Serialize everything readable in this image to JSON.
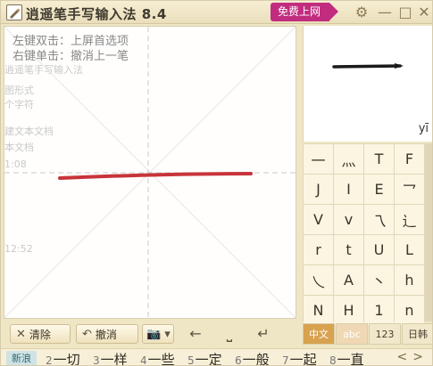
{
  "window": {
    "title": "逍遥笔手写输入法 8.4",
    "free_net_label": "免费上网",
    "settings_icon": "gear-icon",
    "minimize_label": "—",
    "maximize_label": "□",
    "close_label": "✕"
  },
  "canvas": {
    "hint_double": "左键双击：上屏首选项",
    "hint_single": "右键单击：撤消上一笔",
    "background_ghost_text": [
      "逍遥笔手写输入法",
      "图形式",
      "个字符",
      "建文本文档",
      "本文档",
      "1:08",
      "12:52"
    ],
    "stroke_color": "#c8343a"
  },
  "preview": {
    "pinyin": "yī"
  },
  "candidates_grid": [
    [
      "一",
      "灬",
      "T",
      "F"
    ],
    [
      "J",
      "I",
      "E",
      "乛"
    ],
    [
      "V",
      "v",
      "乁",
      "辶"
    ],
    [
      "r",
      "t",
      "U",
      "L"
    ],
    [
      "乀",
      "A",
      "丶",
      "h"
    ],
    [
      "N",
      "H",
      "1",
      "n"
    ]
  ],
  "modes": [
    {
      "label": "中文",
      "active": true
    },
    {
      "label": "abc",
      "active": false
    },
    {
      "label": "123",
      "active": false
    },
    {
      "label": "日韩",
      "active": false
    }
  ],
  "toolbar": {
    "clear_label": "清除",
    "undo_label": "撤消",
    "camera_icon": "camera-icon",
    "backspace_label": "←",
    "space_label": "⎵",
    "enter_label": "↵"
  },
  "candidate_bar": {
    "badge": "新浪",
    "items": [
      {
        "num": "2",
        "text": "一切"
      },
      {
        "num": "3",
        "text": "一样"
      },
      {
        "num": "4",
        "text": "一些"
      },
      {
        "num": "5",
        "text": "一定"
      },
      {
        "num": "6",
        "text": "一般"
      },
      {
        "num": "7",
        "text": "一起"
      },
      {
        "num": "8",
        "text": "一直"
      }
    ],
    "prev_label": "<",
    "next_label": ">"
  }
}
